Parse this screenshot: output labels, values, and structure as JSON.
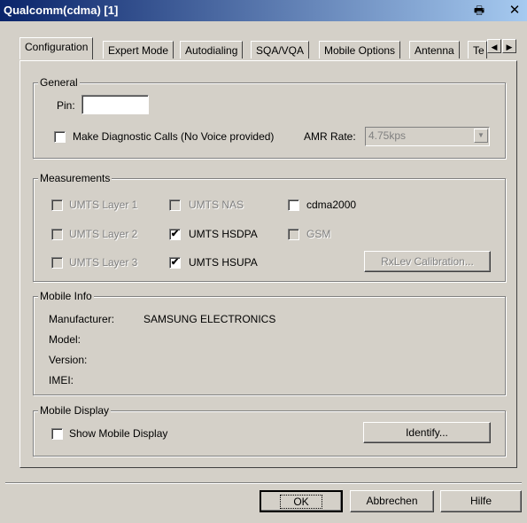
{
  "window": {
    "title": "Qualcomm(cdma) [1]",
    "print_icon": "printer-icon",
    "close_label": "✕"
  },
  "tabs": [
    "Configuration",
    "Expert Mode",
    "Autodialing",
    "SQA/VQA",
    "Mobile Options",
    "Antenna",
    "Te"
  ],
  "tab_scroll": {
    "left": "◀",
    "right": "▶"
  },
  "general": {
    "title": "General",
    "pin_label": "Pin:",
    "pin_value": "",
    "diag_label": "Make Diagnostic Calls (No Voice provided)",
    "amr_label": "AMR Rate:",
    "amr_value": "4.75kps"
  },
  "measurements": {
    "title": "Measurements",
    "items": [
      {
        "label": "UMTS Layer 1",
        "checked": false,
        "enabled": false
      },
      {
        "label": "UMTS NAS",
        "checked": false,
        "enabled": false
      },
      {
        "label": "cdma2000",
        "checked": false,
        "enabled": true
      },
      {
        "label": "UMTS Layer 2",
        "checked": false,
        "enabled": false
      },
      {
        "label": "UMTS HSDPA",
        "checked": true,
        "enabled": true
      },
      {
        "label": "GSM",
        "checked": false,
        "enabled": false
      },
      {
        "label": "UMTS Layer 3",
        "checked": false,
        "enabled": false
      },
      {
        "label": "UMTS HSUPA",
        "checked": true,
        "enabled": true
      }
    ],
    "rxlev_button": "RxLev Calibration..."
  },
  "mobile_info": {
    "title": "Mobile Info",
    "manufacturer_label": "Manufacturer:",
    "manufacturer_value": "SAMSUNG ELECTRONICS",
    "model_label": "Model:",
    "version_label": "Version:",
    "imei_label": "IMEI:"
  },
  "mobile_display": {
    "title": "Mobile Display",
    "show_label": "Show Mobile Display",
    "identify_button": "Identify..."
  },
  "buttons": {
    "ok": "OK",
    "cancel": "Abbrechen",
    "help": "Hilfe"
  },
  "check_mark": "✔"
}
